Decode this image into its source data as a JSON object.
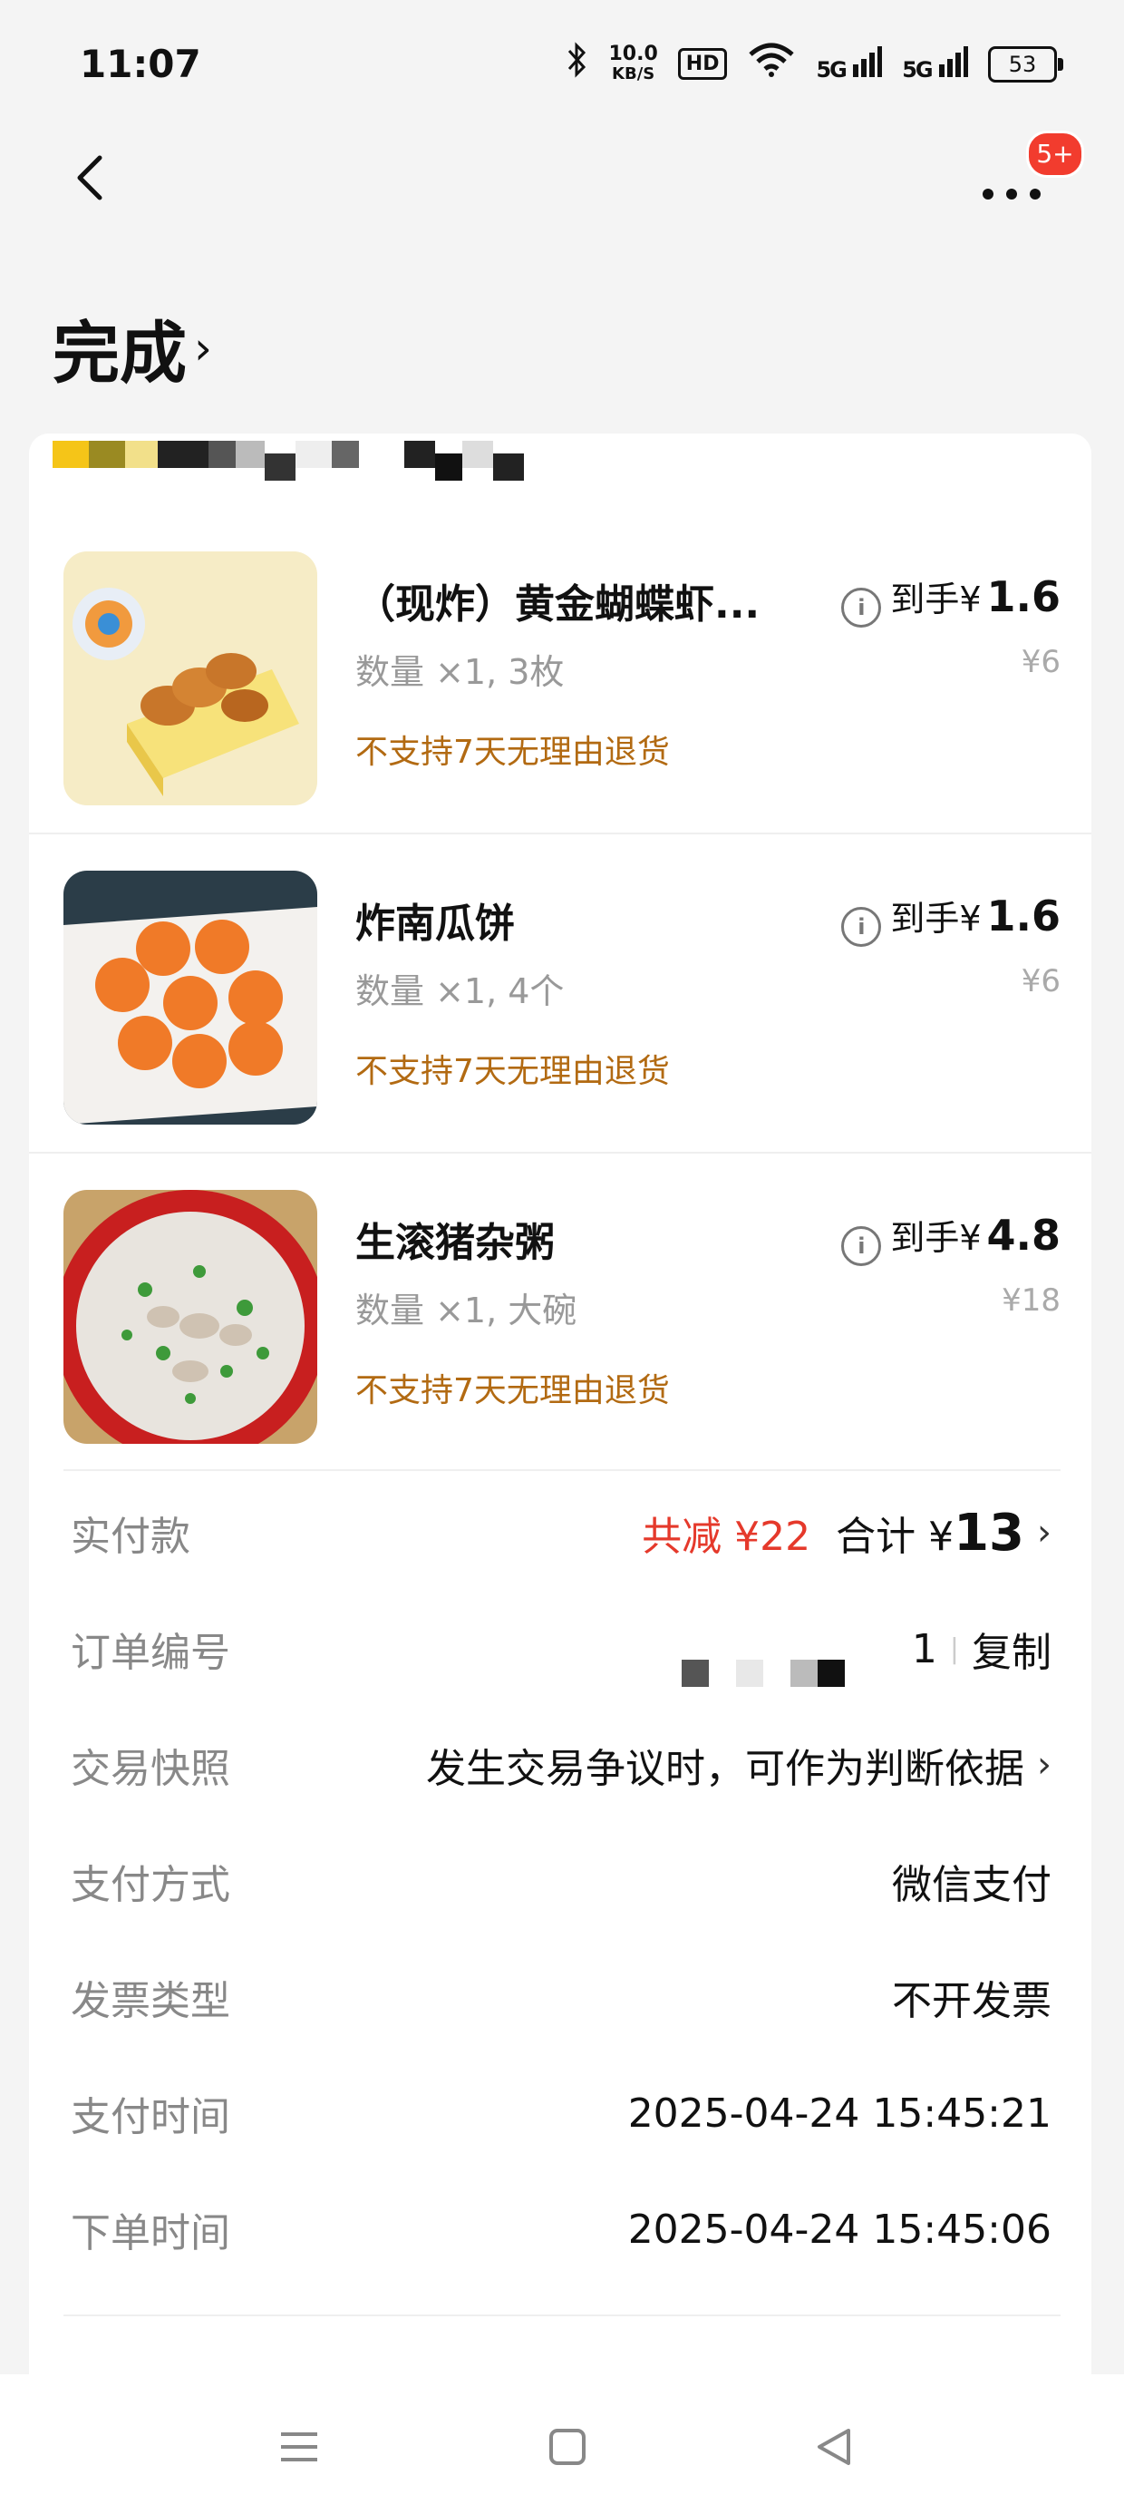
{
  "status_bar": {
    "time": "11:07",
    "net_speed_value": "10.0",
    "net_speed_unit": "KB/S",
    "hd_label": "HD",
    "signal_1": "5G",
    "signal_2": "5G",
    "battery": "53"
  },
  "header": {
    "notification_badge": "5+",
    "order_status": "完成"
  },
  "items": [
    {
      "name": "（现炸）黄金蝴蝶虾...",
      "qty": "数量 ×1, 3枚",
      "policy": "不支持7天无理由退货",
      "price_prefix": "到手¥",
      "price": "1.6",
      "original_price": "¥6"
    },
    {
      "name": "炸南瓜饼",
      "qty": "数量 ×1, 4个",
      "policy": "不支持7天无理由退货",
      "price_prefix": "到手¥",
      "price": "1.6",
      "original_price": "¥6"
    },
    {
      "name": "生滚猪杂粥",
      "qty": "数量 ×1, 大碗",
      "policy": "不支持7天无理由退货",
      "price_prefix": "到手¥",
      "price": "4.8",
      "original_price": "¥18"
    }
  ],
  "summary": {
    "paid_label": "实付款",
    "discount_text": "共减 ¥22",
    "total_prefix": "合计 ¥",
    "total_value": "13",
    "order_no_label": "订单编号",
    "order_no_tail": "1",
    "copy_label": "复制",
    "snapshot_label": "交易快照",
    "snapshot_value": "发生交易争议时，可作为判断依据",
    "payment_label": "支付方式",
    "payment_value": "微信支付",
    "invoice_label": "发票类型",
    "invoice_value": "不开发票",
    "pay_time_label": "支付时间",
    "pay_time_value": "2025-04-24 15:45:21",
    "order_time_label": "下单时间",
    "order_time_value": "2025-04-24 15:45:06"
  },
  "icons": {
    "back": "chevron-left-icon",
    "more": "more-dots-icon",
    "info": "info-icon",
    "chevron": "chevron-right-icon",
    "nav_menu": "menu-icon",
    "nav_home": "square-home-icon",
    "nav_back": "triangle-back-icon"
  },
  "colors": {
    "accent_red": "#e5392b",
    "policy_orange": "#b26a12",
    "badge_red": "#f23c2e",
    "background": "#f4f4f4"
  }
}
